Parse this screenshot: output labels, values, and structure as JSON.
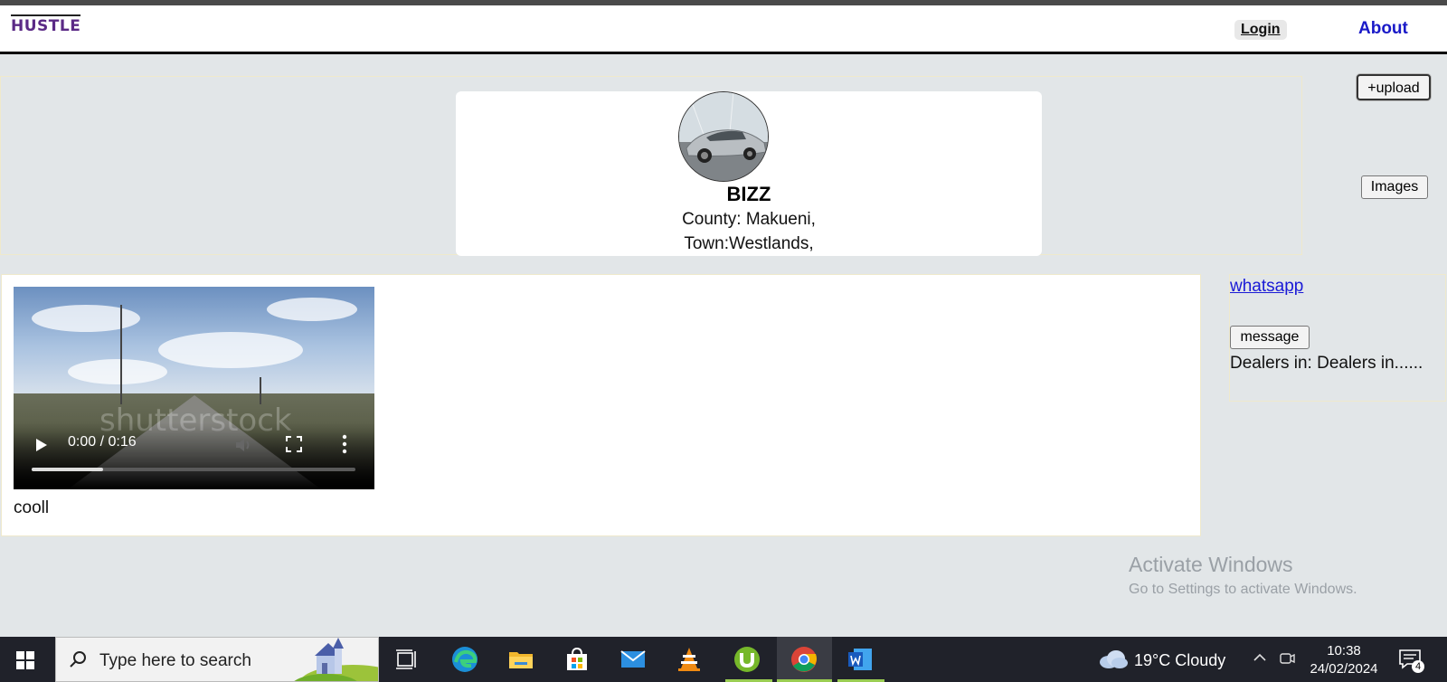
{
  "nav": {
    "logo": "HUSTLE",
    "login": "Login",
    "about": "About"
  },
  "profile": {
    "name": "BIZZ",
    "county": "County: Makueni,",
    "town": "Town:Westlands,"
  },
  "buttons": {
    "upload": "+upload",
    "images": "Images",
    "message": "message"
  },
  "post": {
    "video_time": "0:00 / 0:16",
    "video_progress": 0.22,
    "watermark": "shutterstock",
    "caption": "cooll"
  },
  "side": {
    "whatsapp": "whatsapp",
    "dealers": "Dealers in: Dealers in......"
  },
  "activation": {
    "title": "Activate Windows",
    "subtitle": "Go to Settings to activate Windows."
  },
  "taskbar": {
    "search_placeholder": "Type here to search",
    "weather": "19°C  Cloudy",
    "time": "10:38",
    "date": "24/02/2024",
    "notification_count": "4",
    "icons": [
      "task-view-icon",
      "edge-icon",
      "file-explorer-icon",
      "microsoft-store-icon",
      "mail-icon",
      "vlc-icon",
      "utorrent-icon",
      "chrome-icon",
      "word-icon"
    ]
  },
  "colors": {
    "logo": "#5b2a86",
    "about_link": "#1a1ac8",
    "page_bg": "#e2e6e8",
    "taskbar_bg": "#20222a"
  }
}
